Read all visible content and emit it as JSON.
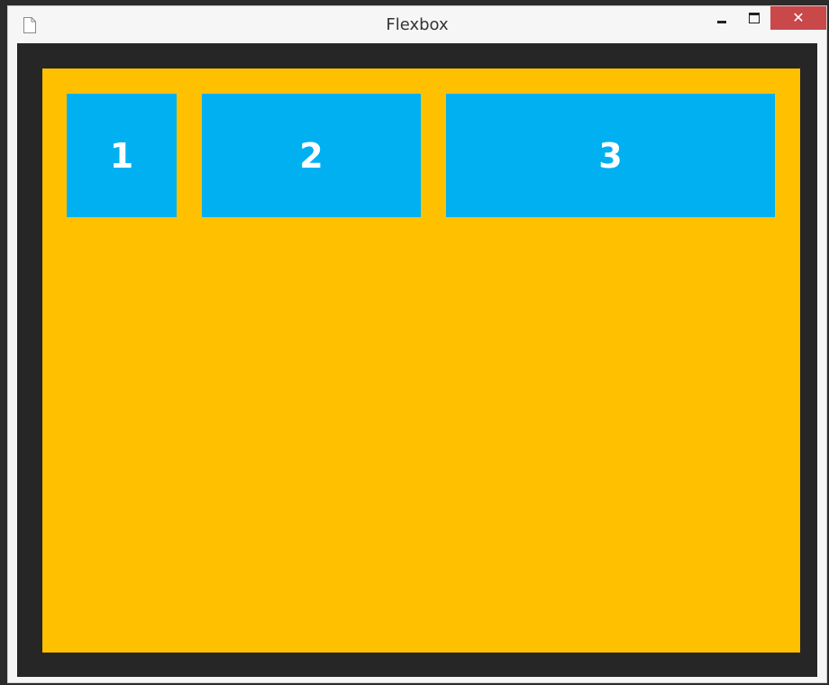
{
  "window": {
    "title": "Flexbox",
    "icon": "document-icon",
    "controls": {
      "minimize": "minimize-icon",
      "maximize": "maximize-icon",
      "close_label": "✕"
    }
  },
  "colors": {
    "client_background": "#262626",
    "container_background": "#ffc000",
    "item_background": "#00b0f0",
    "item_text": "#ffffff",
    "close_button": "#c9484a"
  },
  "flexbox": {
    "items": [
      {
        "label": "1"
      },
      {
        "label": "2"
      },
      {
        "label": "3"
      }
    ]
  }
}
